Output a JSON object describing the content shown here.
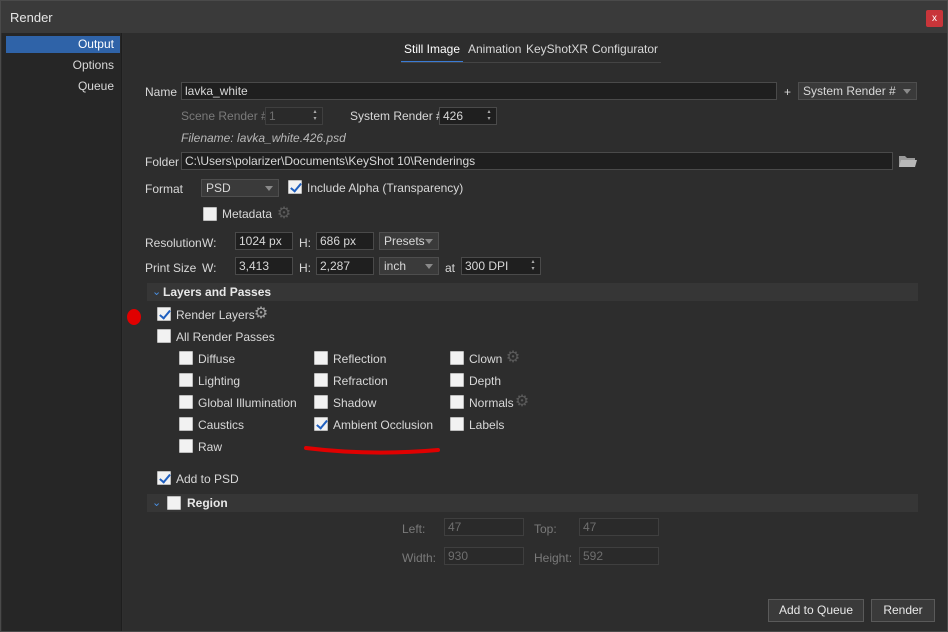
{
  "window": {
    "title": "Render",
    "close": "x"
  },
  "sidebar": {
    "items": [
      {
        "label": "Output"
      },
      {
        "label": "Options"
      },
      {
        "label": "Queue"
      }
    ]
  },
  "tabs": [
    {
      "label": "Still Image"
    },
    {
      "label": "Animation"
    },
    {
      "label": "KeyShotXR"
    },
    {
      "label": "Configurator"
    }
  ],
  "output": {
    "name_label": "Name",
    "name_value": "lavka_white",
    "plus": "+",
    "name_suffix": "System Render #",
    "scene_render_label": "Scene Render #",
    "scene_render_value": "1",
    "system_render_label": "System Render #",
    "system_render_value": "426",
    "filename": "Filename: lavka_white.426.psd",
    "folder_label": "Folder",
    "folder_value": "C:\\Users\\polarizer\\Documents\\KeyShot 10\\Renderings",
    "format_label": "Format",
    "format_value": "PSD",
    "include_alpha": "Include Alpha (Transparency)",
    "metadata": "Metadata",
    "resolution_label": "Resolution",
    "w_label": "W:",
    "h_label": "H:",
    "res_w": "1024 px",
    "res_h": "686 px",
    "presets": "Presets",
    "print_size_label": "Print Size",
    "print_w": "3,413",
    "print_h": "2,287",
    "print_unit": "inch",
    "at": "at",
    "dpi": "300 DPI"
  },
  "layers": {
    "title": "Layers and Passes",
    "render_layers": "Render Layers",
    "all_render_passes": "All Render Passes",
    "col1": [
      "Diffuse",
      "Lighting",
      "Global Illumination",
      "Caustics",
      "Raw"
    ],
    "col2": [
      "Reflection",
      "Refraction",
      "Shadow",
      "Ambient Occlusion"
    ],
    "col3": [
      "Clown",
      "Depth",
      "Normals",
      "Labels"
    ],
    "add_to_psd": "Add to PSD"
  },
  "region": {
    "title": "Region",
    "left_label": "Left:",
    "left_value": "47",
    "top_label": "Top:",
    "top_value": "47",
    "width_label": "Width:",
    "width_value": "930",
    "height_label": "Height:",
    "height_value": "592"
  },
  "footer": {
    "add_to_queue": "Add to Queue",
    "render": "Render"
  },
  "colors": {
    "accent": "#2f63a8",
    "annotation": "#e00000",
    "close": "#c8353a"
  }
}
